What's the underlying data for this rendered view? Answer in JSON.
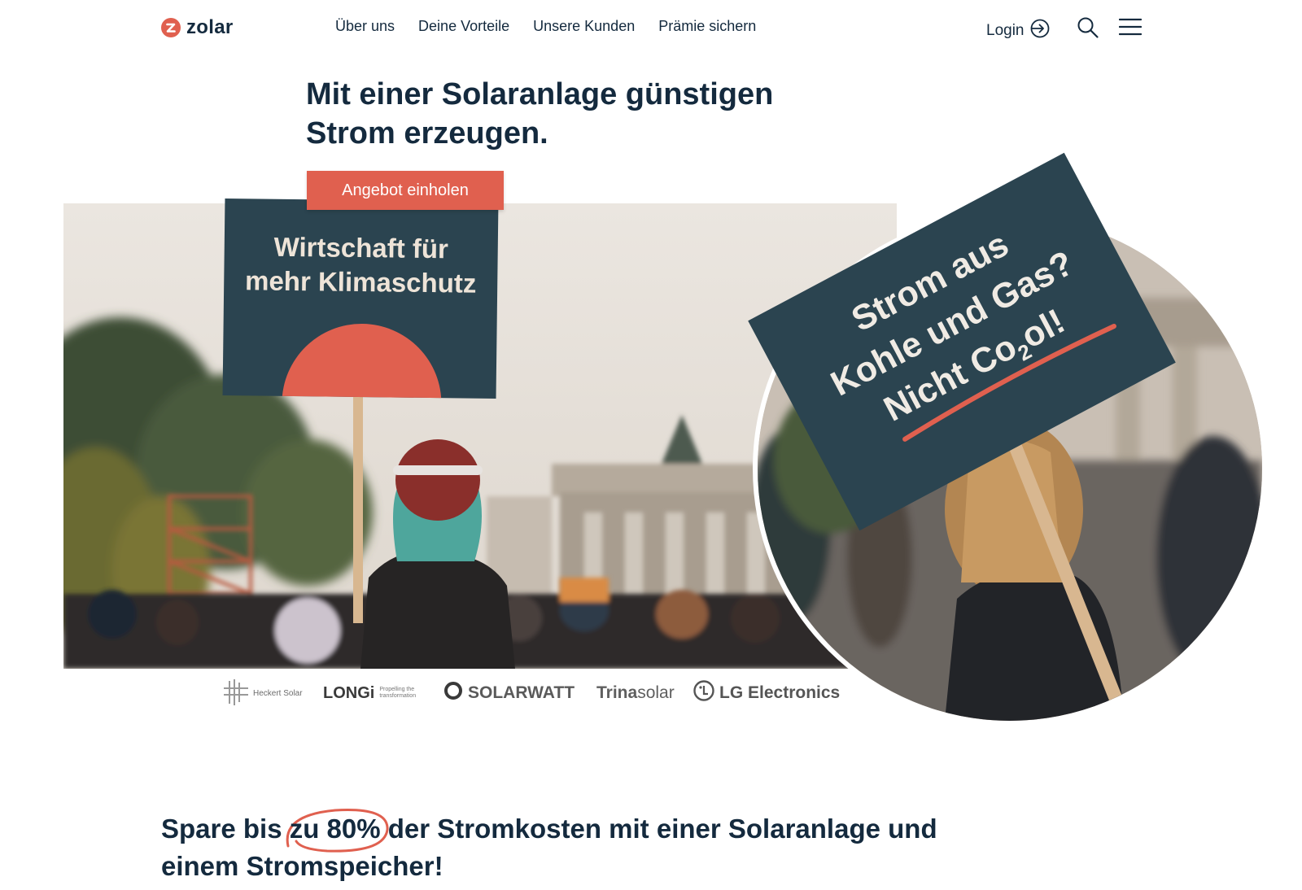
{
  "header": {
    "logo_text": "zolar",
    "nav": [
      {
        "label": "Über uns"
      },
      {
        "label": "Deine Vorteile"
      },
      {
        "label": "Unsere Kunden"
      },
      {
        "label": "Prämie sichern"
      }
    ],
    "login_label": "Login"
  },
  "hero": {
    "title_line1": "Mit einer Solaranlage günstigen",
    "title_line2": "Strom erzeugen.",
    "cta_label": "Angebot einholen",
    "sign_left_line1": "Wirtschaft für",
    "sign_left_line2": "mehr Klimaschutz",
    "sign_right_line1": "Strom aus",
    "sign_right_line2": "Kohle und Gas?",
    "sign_right_line3a": "Nicht Co",
    "sign_right_line3sub": "2",
    "sign_right_line3b": "ol!"
  },
  "partners": {
    "heckert": "Heckert Solar",
    "longi": "LONGi",
    "longi_tagline1": "Propelling the",
    "longi_tagline2": "transformation",
    "solarwatt": "SOLARWATT",
    "trina_bold": "Trina",
    "trina_light": "solar",
    "lg": "LG Electronics"
  },
  "savings": {
    "part1": "Spare bis ",
    "highlight": "zu 80%",
    "part2": " der Stromkosten mit einer Solaranlage und",
    "line2": "einem Stromspeicher!"
  },
  "colors": {
    "brand_red": "#e0604f",
    "navy": "#142a3e",
    "sign_teal": "#2b4450"
  }
}
